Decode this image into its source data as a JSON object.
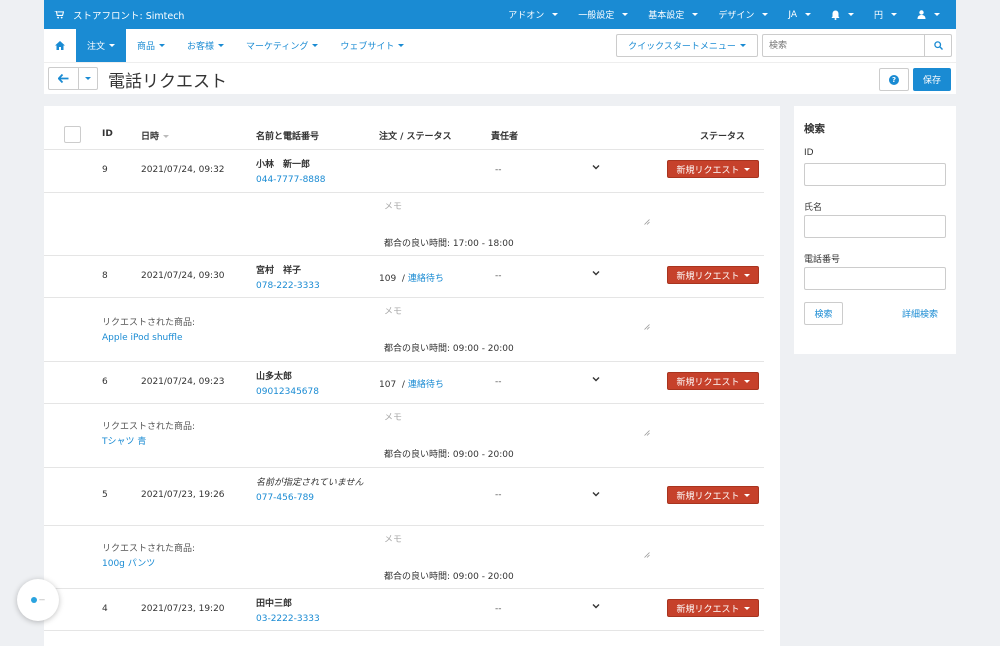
{
  "topbar": {
    "brand": "ストアフロント: Simtech",
    "menu": [
      "アドオン",
      "一般設定",
      "基本設定",
      "デザイン",
      "JA",
      "",
      "円",
      ""
    ]
  },
  "nav": {
    "items": [
      "注文",
      "商品",
      "お客様",
      "マーケティング",
      "ウェブサイト"
    ],
    "quickstart": "クイックスタートメニュー",
    "search_placeholder": "検索"
  },
  "page": {
    "title": "電話リクエスト",
    "save": "保存"
  },
  "table": {
    "headers": {
      "id": "ID",
      "date": "日時",
      "name": "名前と電話番号",
      "order": "注文 / ステータス",
      "resp": "責任者",
      "status": "ステータス"
    },
    "memo_placeholder": "メモ",
    "rows": [
      {
        "id": "9",
        "date": "2021/07/24, 09:32",
        "name": "小林　新一郎",
        "phone": "044-7777-8888",
        "order_num": "",
        "order_status": "",
        "resp": "--",
        "status": "新規リクエスト",
        "req_label": "",
        "req_product": "",
        "time": "都合の良い時間: 17:00 - 18:00"
      },
      {
        "id": "8",
        "date": "2021/07/24, 09:30",
        "name": "宮村　祥子",
        "phone": "078-222-3333",
        "order_num": "109",
        "order_status": "連絡待ち",
        "resp": "--",
        "status": "新規リクエスト",
        "req_label": "リクエストされた商品:",
        "req_product": "Apple iPod shuffle",
        "time": "都合の良い時間: 09:00 - 20:00"
      },
      {
        "id": "6",
        "date": "2021/07/24, 09:23",
        "name": "山多太郎",
        "phone": "09012345678",
        "order_num": "107",
        "order_status": "連絡待ち",
        "resp": "--",
        "status": "新規リクエスト",
        "req_label": "リクエストされた商品:",
        "req_product": "Tシャツ 青",
        "time": "都合の良い時間: 09:00 - 20:00"
      },
      {
        "id": "5",
        "date": "2021/07/23, 19:26",
        "name": "名前が指定されていません",
        "phone": "077-456-789",
        "order_num": "",
        "order_status": "",
        "resp": "--",
        "status": "新規リクエスト",
        "req_label": "リクエストされた商品:",
        "req_product": "100g パンツ",
        "time": "都合の良い時間: 09:00 - 20:00"
      },
      {
        "id": "4",
        "date": "2021/07/23, 19:20",
        "name": "田中三郎",
        "phone": "03-2222-3333",
        "order_num": "",
        "order_status": "",
        "resp": "--",
        "status": "新規リクエスト"
      }
    ]
  },
  "sidebar": {
    "title": "検索",
    "labels": [
      "ID",
      "氏名",
      "電話番号"
    ],
    "search_btn": "検索",
    "advanced": "詳細検索"
  },
  "colors": {
    "accent": "#1a8bd3",
    "status": "#c6412b"
  }
}
